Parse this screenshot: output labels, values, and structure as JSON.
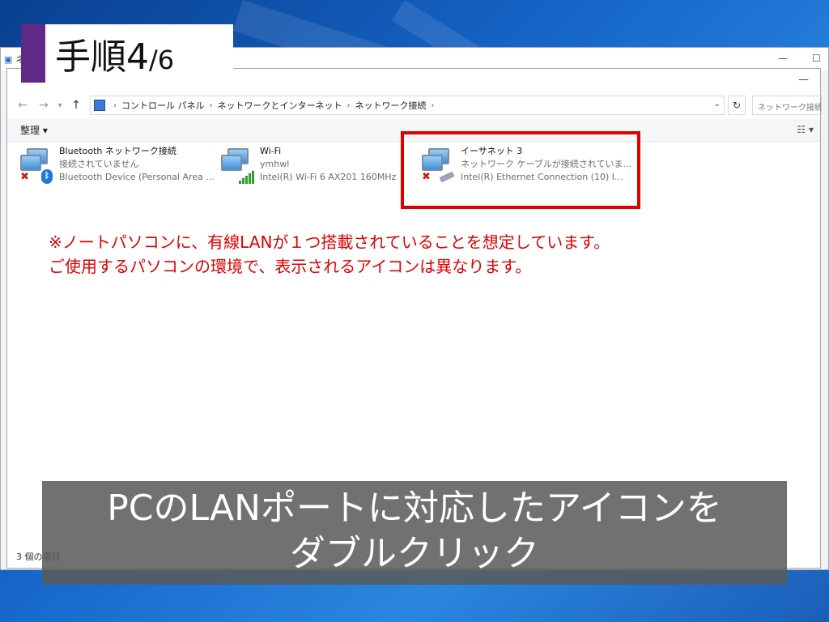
{
  "back_window": {
    "title": "ネッ"
  },
  "address_bar": {
    "crumbs": [
      "コントロール パネル",
      "ネットワークとインターネット",
      "ネットワーク接続"
    ],
    "search_placeholder": "ネットワーク接続の検"
  },
  "command_bar": {
    "organize_label": "整理 ▾"
  },
  "connections": [
    {
      "name": "Bluetooth ネットワーク接続",
      "status": "接続されていません",
      "device": "Bluetooth Device (Personal Area ...",
      "icon": "bluetooth-network-icon"
    },
    {
      "name": "Wi-Fi",
      "status": "ymhwl",
      "device": "Intel(R) Wi-Fi 6 AX201 160MHz",
      "icon": "wifi-network-icon"
    },
    {
      "name": "イーサネット 3",
      "status": "ネットワーク ケーブルが接続されていま...",
      "device": "Intel(R) Ethernet Connection (10) I...",
      "icon": "ethernet-network-icon"
    }
  ],
  "note": {
    "line1": "※ノートパソコンに、有線LANが１つ搭載されていることを想定しています。",
    "line2": "ご使用するパソコンの環境で、表示されるアイコンは異なります。"
  },
  "status_bar": {
    "count": "3 個の項目"
  },
  "step": {
    "main": "手順4",
    "sub": "/6"
  },
  "caption": {
    "line1": "PCのLANポートに対応したアイコンを",
    "line2": "ダブルクリック"
  },
  "colors": {
    "highlight": "#e00000",
    "step_bar": "#5e2a86"
  }
}
